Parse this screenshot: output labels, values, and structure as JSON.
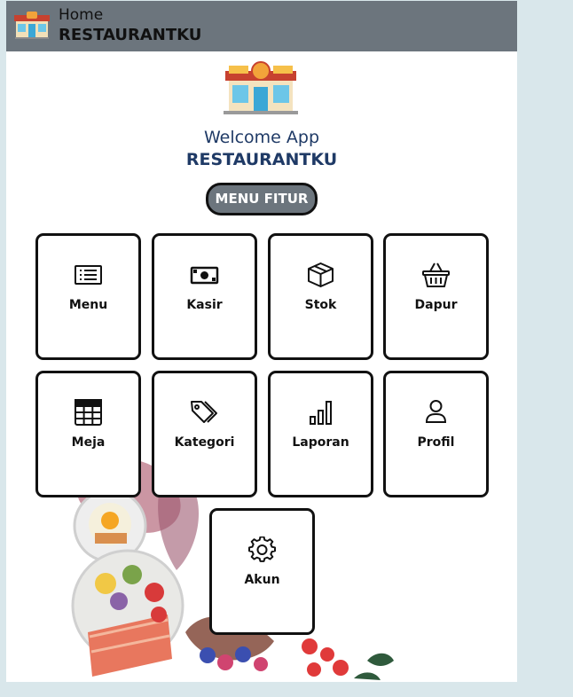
{
  "header": {
    "title": "Home",
    "subtitle": "RESTAURANTKU"
  },
  "welcome": {
    "line1": "Welcome App",
    "line2": "RESTAURANTKU"
  },
  "menu_button": {
    "label": "MENU FITUR"
  },
  "features": [
    {
      "label": "Menu",
      "icon": "list-icon"
    },
    {
      "label": "Kasir",
      "icon": "cash-icon"
    },
    {
      "label": "Stok",
      "icon": "box-icon"
    },
    {
      "label": "Dapur",
      "icon": "basket-icon"
    },
    {
      "label": "Meja",
      "icon": "table-icon"
    },
    {
      "label": "Kategori",
      "icon": "tags-icon"
    },
    {
      "label": "Laporan",
      "icon": "bar-chart-icon"
    },
    {
      "label": "Profil",
      "icon": "person-icon"
    },
    {
      "label": "Akun",
      "icon": "gear-icon"
    }
  ],
  "colors": {
    "header": "#6c757d",
    "welcome_text": "#1f3a66",
    "page_bg": "#d9e7eb"
  }
}
